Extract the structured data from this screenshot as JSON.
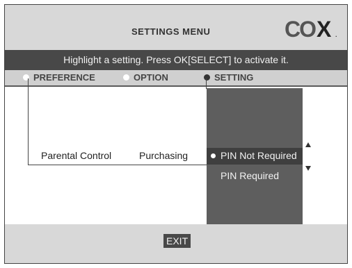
{
  "header": {
    "menu_title": "SETTINGS MENU",
    "logo_text": "CO",
    "logo_x": "X",
    "logo_dot": "."
  },
  "instruction": "Highlight a setting. Press OK[SELECT] to activate it.",
  "tabs": [
    {
      "label": "PREFERENCE"
    },
    {
      "label": "OPTION"
    },
    {
      "label": "SETTING"
    }
  ],
  "content": {
    "preference_value": "Parental Control",
    "option_value": "Purchasing",
    "settings": [
      {
        "label": "PIN Not Required"
      },
      {
        "label": "PIN Required"
      }
    ]
  },
  "footer": {
    "exit_label": "EXIT"
  },
  "colors": {
    "panel": "#5e5e5e",
    "bar": "#484848",
    "header": "#d8d8d8"
  }
}
